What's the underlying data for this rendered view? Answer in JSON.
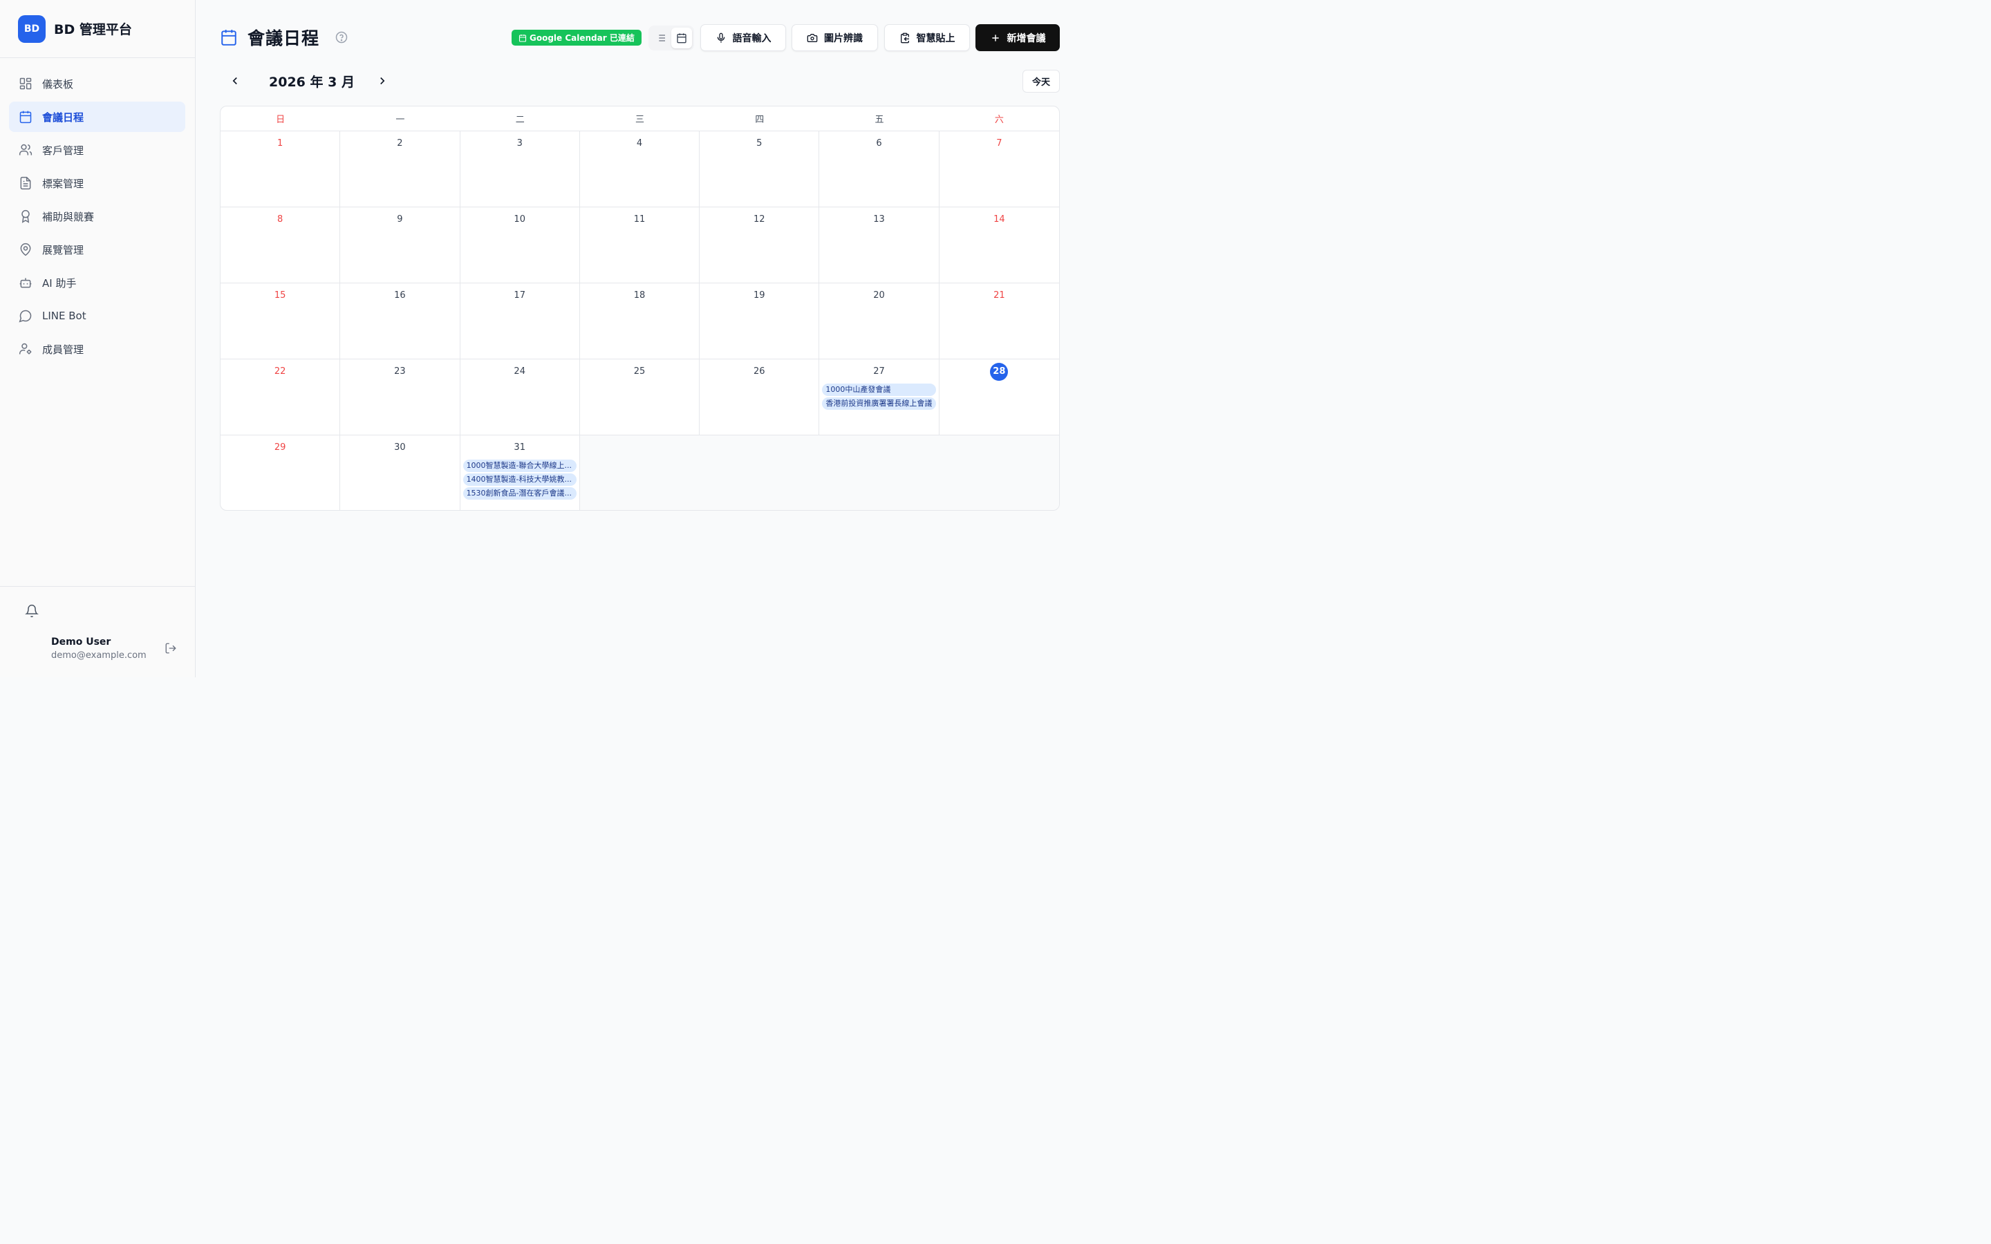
{
  "brand": {
    "logo": "BD",
    "name": "BD 管理平台"
  },
  "sidebar": {
    "items": [
      {
        "label": "儀表板",
        "icon": "dashboard-icon",
        "active": false
      },
      {
        "label": "會議日程",
        "icon": "calendar-icon",
        "active": true
      },
      {
        "label": "客戶管理",
        "icon": "users-icon",
        "active": false
      },
      {
        "label": "標案管理",
        "icon": "document-icon",
        "active": false
      },
      {
        "label": "補助與競賽",
        "icon": "award-icon",
        "active": false
      },
      {
        "label": "展覽管理",
        "icon": "map-pin-icon",
        "active": false
      },
      {
        "label": "AI 助手",
        "icon": "bot-icon",
        "active": false
      },
      {
        "label": "LINE Bot",
        "icon": "chat-bubble-icon",
        "active": false
      },
      {
        "label": "成員管理",
        "icon": "user-settings-icon",
        "active": false
      }
    ]
  },
  "user": {
    "name": "Demo User",
    "email": "demo@example.com"
  },
  "header": {
    "title": "會議日程",
    "gcal_badge": "Google Calendar 已連結",
    "voice_label": "語音輸入",
    "image_label": "圖片辨識",
    "paste_label": "智慧貼上",
    "add_label": "新增會議"
  },
  "calendar": {
    "month_label": "2026 年 3 月",
    "today_label": "今天",
    "weekdays": [
      "日",
      "一",
      "二",
      "三",
      "四",
      "五",
      "六"
    ],
    "today": 28,
    "days": [
      {
        "d": "1",
        "events": []
      },
      {
        "d": "2",
        "events": []
      },
      {
        "d": "3",
        "events": []
      },
      {
        "d": "4",
        "events": []
      },
      {
        "d": "5",
        "events": []
      },
      {
        "d": "6",
        "events": []
      },
      {
        "d": "7",
        "events": []
      },
      {
        "d": "8",
        "events": []
      },
      {
        "d": "9",
        "events": []
      },
      {
        "d": "10",
        "events": []
      },
      {
        "d": "11",
        "events": []
      },
      {
        "d": "12",
        "events": []
      },
      {
        "d": "13",
        "events": []
      },
      {
        "d": "14",
        "events": []
      },
      {
        "d": "15",
        "events": []
      },
      {
        "d": "16",
        "events": []
      },
      {
        "d": "17",
        "events": []
      },
      {
        "d": "18",
        "events": []
      },
      {
        "d": "19",
        "events": []
      },
      {
        "d": "20",
        "events": []
      },
      {
        "d": "21",
        "events": []
      },
      {
        "d": "22",
        "events": []
      },
      {
        "d": "23",
        "events": []
      },
      {
        "d": "24",
        "events": []
      },
      {
        "d": "25",
        "events": []
      },
      {
        "d": "26",
        "events": []
      },
      {
        "d": "27",
        "events": [
          "1000中山產發會議",
          "香港前投資推廣署署長線上會議"
        ]
      },
      {
        "d": "28",
        "events": []
      },
      {
        "d": "29",
        "events": []
      },
      {
        "d": "30",
        "events": []
      },
      {
        "d": "31",
        "events": [
          "1000智慧製造-聯合大學線上...",
          "1400智慧製造-科技大學姚教...",
          "1530創新食品-潛在客戶會議..."
        ]
      }
    ]
  }
}
